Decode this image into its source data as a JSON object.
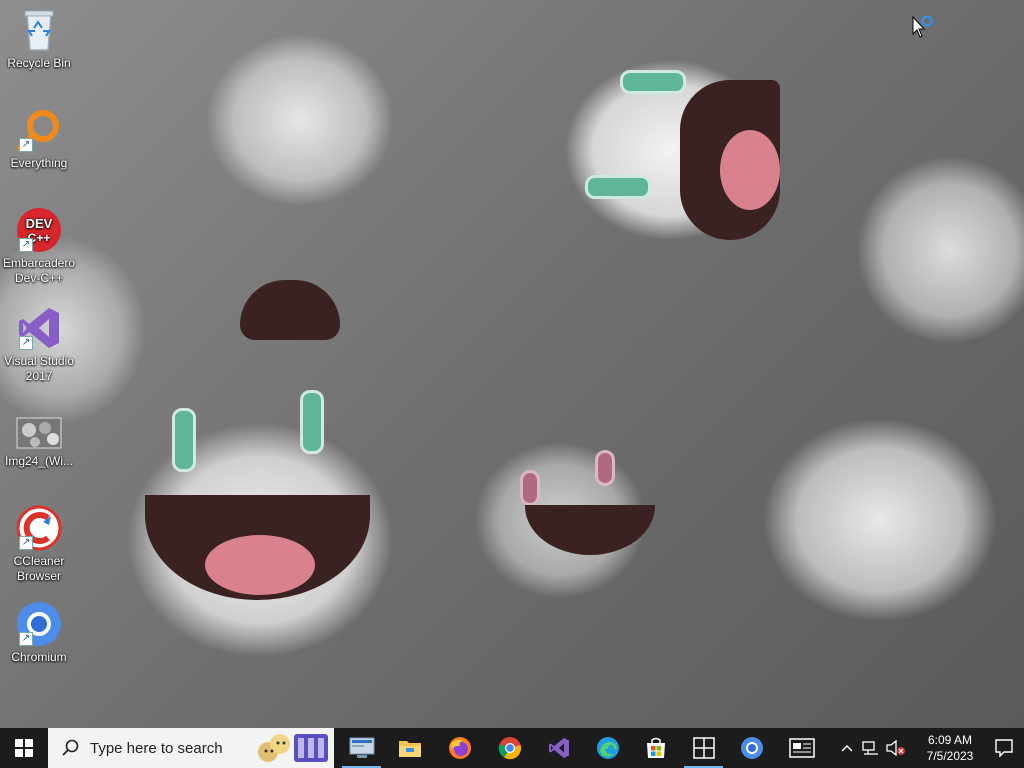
{
  "desktop": {
    "icons": [
      {
        "label": "Recycle Bin",
        "icon": "recycle-bin-icon"
      },
      {
        "label": "Everything",
        "icon": "everything-search-icon"
      },
      {
        "label": "Embarcadero Dev-C++",
        "icon": "devcpp-icon",
        "badge": "DEV C++"
      },
      {
        "label": "Visual Studio 2017",
        "icon": "visual-studio-icon"
      },
      {
        "label": "Img24_(Wi...",
        "icon": "image-thumbnail-icon"
      },
      {
        "label": "CCleaner Browser",
        "icon": "ccleaner-browser-icon"
      },
      {
        "label": "Chromium",
        "icon": "chromium-icon"
      }
    ]
  },
  "taskbar": {
    "start_icon": "windows-start-icon",
    "search_placeholder": "Type here to search",
    "apps": [
      {
        "name": "remote-desktop",
        "icon": "remote-desktop-icon"
      },
      {
        "name": "file-explorer",
        "icon": "file-explorer-icon"
      },
      {
        "name": "firefox",
        "icon": "firefox-icon"
      },
      {
        "name": "chrome",
        "icon": "chrome-icon"
      },
      {
        "name": "visual-studio",
        "icon": "visual-studio-icon"
      },
      {
        "name": "edge",
        "icon": "edge-icon"
      },
      {
        "name": "microsoft-store",
        "icon": "store-icon"
      },
      {
        "name": "windows",
        "icon": "windows-tile-icon"
      },
      {
        "name": "chromium",
        "icon": "chromium-icon"
      },
      {
        "name": "news",
        "icon": "news-icon"
      }
    ],
    "tray": {
      "time": "6:09 AM",
      "date": "7/5/2023"
    }
  },
  "colors": {
    "taskbar": "#1c1c1c",
    "search_box": "#f3f3f3",
    "accent": "#76b9ed"
  }
}
